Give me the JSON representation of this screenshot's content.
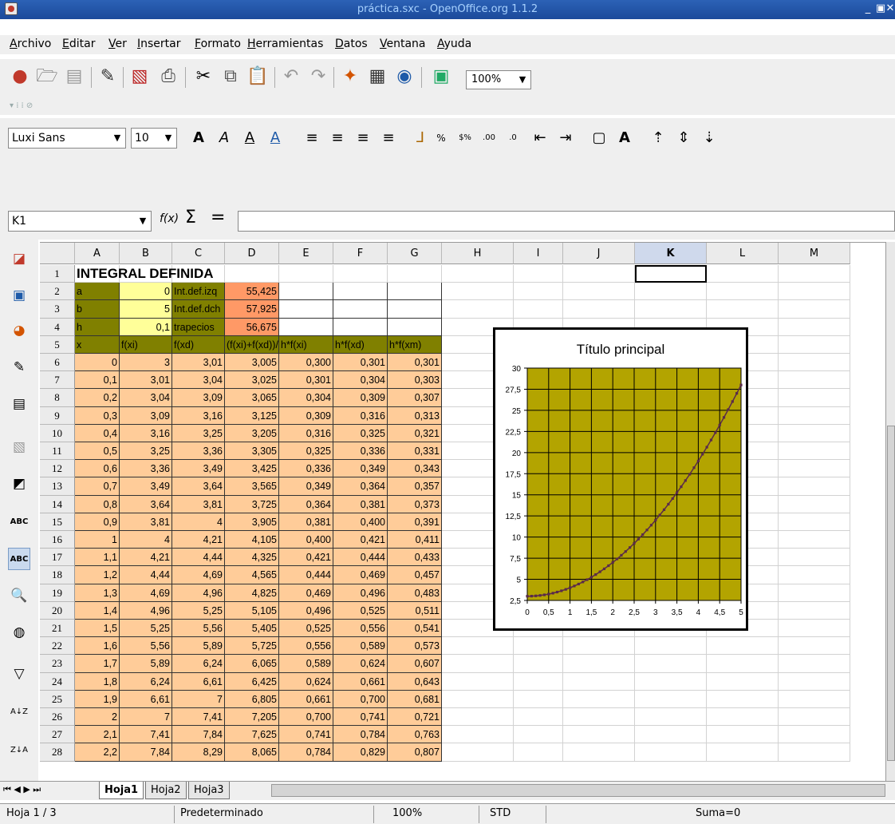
{
  "window": {
    "title": "práctica.sxc - OpenOffice.org 1.1.2"
  },
  "menu": [
    "Archivo",
    "Editar",
    "Ver",
    "Insertar",
    "Formato",
    "Herramientas",
    "Datos",
    "Ventana",
    "Ayuda"
  ],
  "toolbar": {
    "zoom": "100%"
  },
  "format": {
    "font_name": "Luxi Sans",
    "font_size": "10"
  },
  "formula_bar": {
    "cell_ref": "K1",
    "fx_label": "f(x)",
    "sum_symbol": "Σ",
    "equals_symbol": "=",
    "content": ""
  },
  "columns": [
    "A",
    "B",
    "C",
    "D",
    "E",
    "F",
    "G",
    "H",
    "I",
    "J",
    "K",
    "L",
    "M"
  ],
  "sheet": {
    "title": "INTEGRAL DEFINIDA",
    "params": [
      [
        "a",
        "0",
        "Int.def.izq",
        "55,425"
      ],
      [
        "b",
        "5",
        "Int.def.dch",
        "57,925"
      ],
      [
        "h",
        "0,1",
        "trapecios",
        "56,675"
      ]
    ],
    "header": [
      "x",
      "f(xi)",
      "f(xd)",
      "(f(xi)+f(xd))/2",
      "h*f(xi)",
      "h*f(xd)",
      "h*f(xm)"
    ],
    "rows": [
      [
        "0",
        "3",
        "3,01",
        "3,005",
        "0,300",
        "0,301",
        "0,301"
      ],
      [
        "0,1",
        "3,01",
        "3,04",
        "3,025",
        "0,301",
        "0,304",
        "0,303"
      ],
      [
        "0,2",
        "3,04",
        "3,09",
        "3,065",
        "0,304",
        "0,309",
        "0,307"
      ],
      [
        "0,3",
        "3,09",
        "3,16",
        "3,125",
        "0,309",
        "0,316",
        "0,313"
      ],
      [
        "0,4",
        "3,16",
        "3,25",
        "3,205",
        "0,316",
        "0,325",
        "0,321"
      ],
      [
        "0,5",
        "3,25",
        "3,36",
        "3,305",
        "0,325",
        "0,336",
        "0,331"
      ],
      [
        "0,6",
        "3,36",
        "3,49",
        "3,425",
        "0,336",
        "0,349",
        "0,343"
      ],
      [
        "0,7",
        "3,49",
        "3,64",
        "3,565",
        "0,349",
        "0,364",
        "0,357"
      ],
      [
        "0,8",
        "3,64",
        "3,81",
        "3,725",
        "0,364",
        "0,381",
        "0,373"
      ],
      [
        "0,9",
        "3,81",
        "4",
        "3,905",
        "0,381",
        "0,400",
        "0,391"
      ],
      [
        "1",
        "4",
        "4,21",
        "4,105",
        "0,400",
        "0,421",
        "0,411"
      ],
      [
        "1,1",
        "4,21",
        "4,44",
        "4,325",
        "0,421",
        "0,444",
        "0,433"
      ],
      [
        "1,2",
        "4,44",
        "4,69",
        "4,565",
        "0,444",
        "0,469",
        "0,457"
      ],
      [
        "1,3",
        "4,69",
        "4,96",
        "4,825",
        "0,469",
        "0,496",
        "0,483"
      ],
      [
        "1,4",
        "4,96",
        "5,25",
        "5,105",
        "0,496",
        "0,525",
        "0,511"
      ],
      [
        "1,5",
        "5,25",
        "5,56",
        "5,405",
        "0,525",
        "0,556",
        "0,541"
      ],
      [
        "1,6",
        "5,56",
        "5,89",
        "5,725",
        "0,556",
        "0,589",
        "0,573"
      ],
      [
        "1,7",
        "5,89",
        "6,24",
        "6,065",
        "0,589",
        "0,624",
        "0,607"
      ],
      [
        "1,8",
        "6,24",
        "6,61",
        "6,425",
        "0,624",
        "0,661",
        "0,643"
      ],
      [
        "1,9",
        "6,61",
        "7",
        "6,805",
        "0,661",
        "0,700",
        "0,681"
      ],
      [
        "2",
        "7",
        "7,41",
        "7,205",
        "0,700",
        "0,741",
        "0,721"
      ],
      [
        "2,1",
        "7,41",
        "7,84",
        "7,625",
        "0,741",
        "0,784",
        "0,763"
      ],
      [
        "2,2",
        "7,84",
        "8,29",
        "8,065",
        "0,784",
        "0,829",
        "0,807"
      ]
    ]
  },
  "chart_data": {
    "type": "line",
    "title": "Título principal",
    "x": [
      0,
      0.1,
      0.2,
      0.3,
      0.4,
      0.5,
      0.6,
      0.7,
      0.8,
      0.9,
      1,
      1.1,
      1.2,
      1.3,
      1.4,
      1.5,
      1.6,
      1.7,
      1.8,
      1.9,
      2,
      2.1,
      2.2,
      2.3,
      2.4,
      2.5,
      2.6,
      2.7,
      2.8,
      2.9,
      3,
      3.1,
      3.2,
      3.3,
      3.4,
      3.5,
      3.6,
      3.7,
      3.8,
      3.9,
      4,
      4.1,
      4.2,
      4.3,
      4.4,
      4.5,
      4.6,
      4.7,
      4.8,
      4.9,
      5
    ],
    "series": [
      {
        "values": [
          3,
          3.01,
          3.04,
          3.09,
          3.16,
          3.25,
          3.36,
          3.49,
          3.64,
          3.81,
          4,
          4.21,
          4.44,
          4.69,
          4.96,
          5.25,
          5.56,
          5.89,
          6.24,
          6.61,
          7,
          7.41,
          7.84,
          8.29,
          8.76,
          9.25,
          9.76,
          10.29,
          10.84,
          11.41,
          12,
          12.61,
          13.24,
          13.89,
          14.56,
          15.25,
          15.96,
          16.69,
          17.44,
          18.21,
          19,
          19.81,
          20.64,
          21.49,
          22.36,
          23.25,
          24.16,
          25.09,
          26.04,
          27.01,
          28
        ]
      }
    ],
    "xlim": [
      0,
      5
    ],
    "ylim": [
      2.5,
      30
    ],
    "xticks": [
      "0",
      "0,5",
      "1",
      "1,5",
      "2",
      "2,5",
      "3",
      "3,5",
      "4",
      "4,5",
      "5"
    ],
    "yticks": [
      "2,5",
      "5",
      "7,5",
      "10",
      "12,5",
      "15",
      "17,5",
      "20",
      "22,5",
      "25",
      "27,5",
      "30"
    ],
    "grid": true,
    "colors": {
      "plot_bg": "#b3a400",
      "line": "#5a2a4a",
      "grid": "#000000"
    }
  },
  "tabs": [
    "Hoja1",
    "Hoja2",
    "Hoja3"
  ],
  "status": {
    "sheet": "Hoja 1 / 3",
    "style": "Predeterminado",
    "zoom": "100%",
    "mode": "STD",
    "sum": "Suma=0"
  },
  "colors": {
    "olive": "#808000",
    "yellow": "#ffff99",
    "orange_dark": "#ff9966",
    "orange_light": "#ffcc99",
    "header_row": "#808000"
  }
}
